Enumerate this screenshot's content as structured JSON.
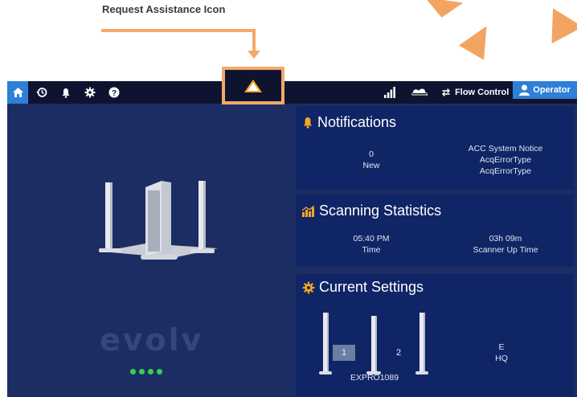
{
  "annotation": {
    "label": "Request Assistance Icon"
  },
  "topbar": {
    "flow_control_label": "Flow Control",
    "operator_label": "Operator",
    "icons": [
      "home-icon",
      "history-icon",
      "bell-icon",
      "gear-icon",
      "help-icon",
      "warning-icon",
      "signal-icon",
      "cloud-icon",
      "swap-icon",
      "user-icon"
    ]
  },
  "left": {
    "logo": "evolv"
  },
  "notifications": {
    "title": "Notifications",
    "count": "0",
    "count_label": "New",
    "notice_title": "ACC System Notice",
    "notice_line1": "AcqErrorType",
    "notice_line2": "AcqErrorType"
  },
  "scanning": {
    "title": "Scanning Statistics",
    "time_value": "05:40 PM",
    "time_label": "Time",
    "uptime_value": "03h 09m",
    "uptime_label": "Scanner Up Time"
  },
  "settings": {
    "title": "Current Settings",
    "lane1": "1",
    "lane2": "2",
    "device_id": "EXPRO1089",
    "code": "E",
    "location": "HQ"
  },
  "colors": {
    "accent": "#2d7fd8",
    "panel": "#102566",
    "bg": "#1c2d63",
    "topbar": "#0e1430",
    "highlight": "#f4a86a",
    "icon_orange": "#f5a623",
    "status_green": "#3bd04a"
  }
}
